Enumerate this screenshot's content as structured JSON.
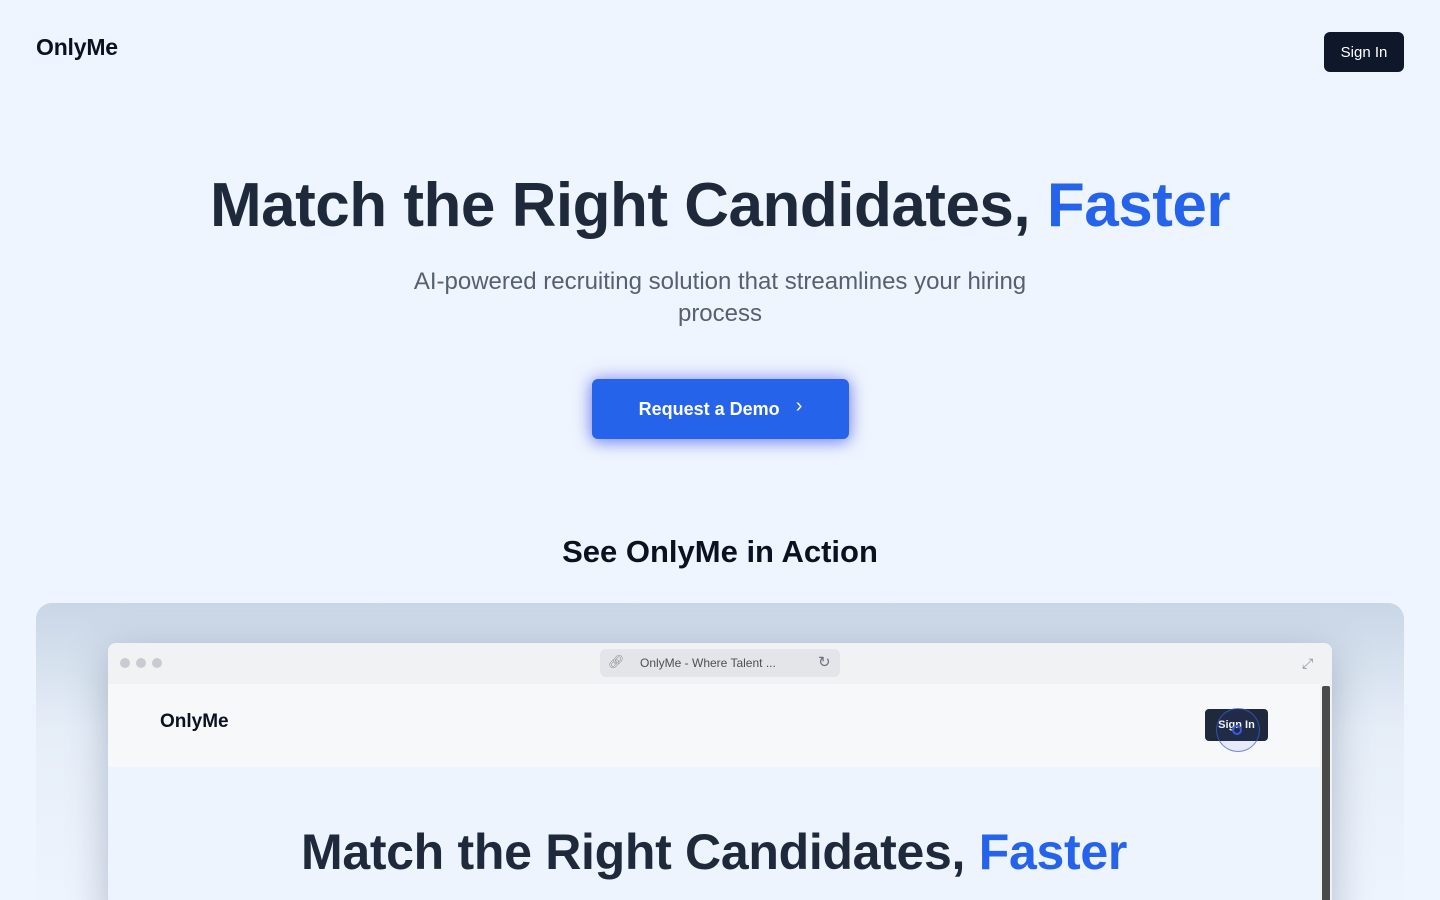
{
  "nav": {
    "logo": "OnlyMe",
    "sign_in_label": "Sign In"
  },
  "hero": {
    "title_main": "Match the Right Candidates, ",
    "title_accent": "Faster",
    "subtitle": "AI-powered recruiting solution that streamlines your hiring process",
    "cta_label": "Request a Demo",
    "cta_icon": "chevron-right-icon"
  },
  "section": {
    "title": "See OnlyMe in Action"
  },
  "preview": {
    "browser": {
      "url_title": "OnlyMe - Where Talent ...",
      "link_icon": "link-icon",
      "reload_icon": "reload-icon",
      "expand_icon": "expand-icon"
    },
    "inner_nav": {
      "logo": "OnlyMe",
      "sign_in_label": "Sign In"
    },
    "inner_hero": {
      "title_main": "Match the Right Candidates, ",
      "title_accent": "Faster"
    }
  },
  "colors": {
    "background": "#eff5fe",
    "accent": "#2563eb",
    "dark": "#0f172a",
    "text": "#1e293b"
  }
}
